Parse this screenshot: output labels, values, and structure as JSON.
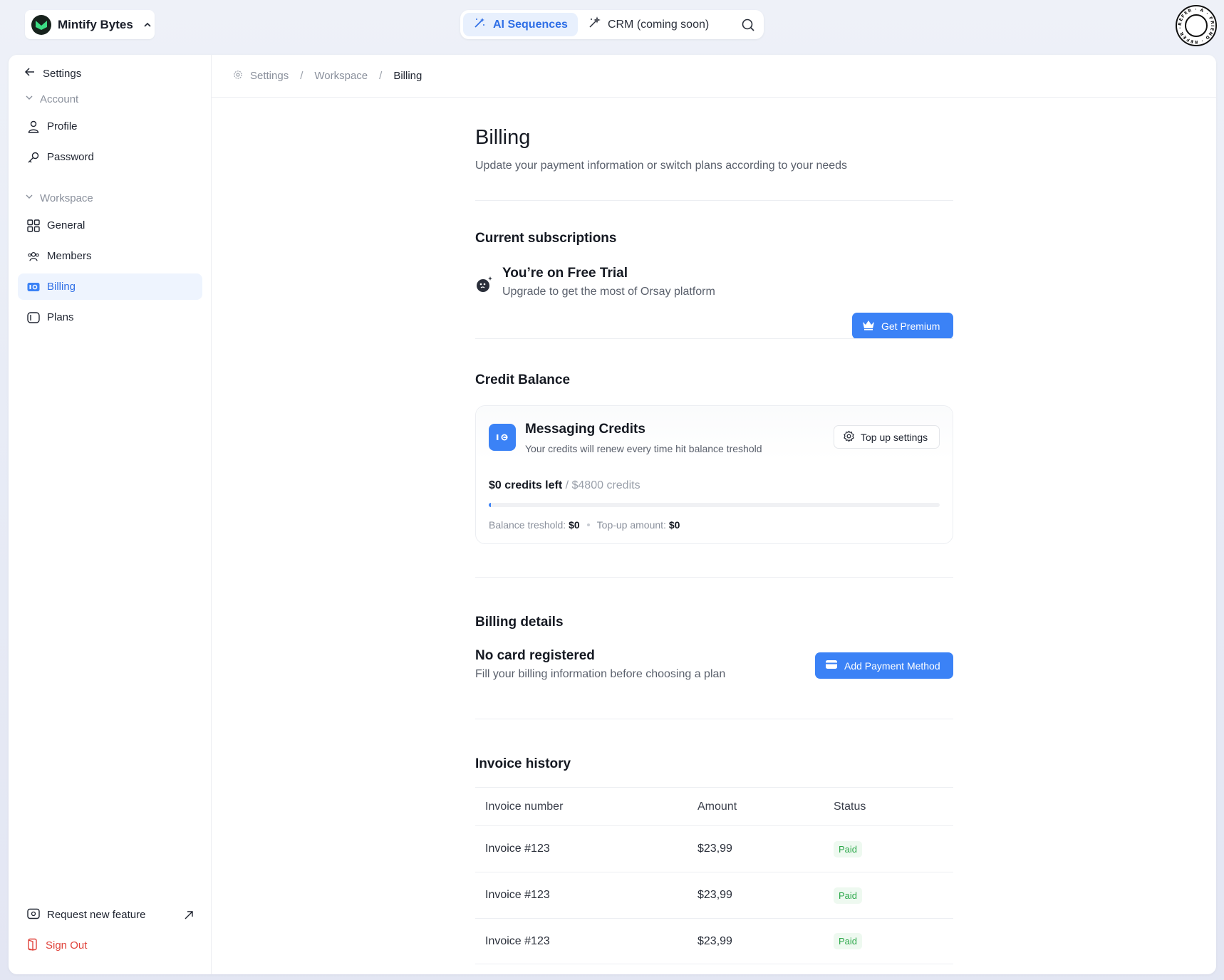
{
  "workspace": {
    "name": "Mintify Bytes"
  },
  "top_nav": {
    "tabs": [
      {
        "label": "AI Sequences",
        "active": true
      },
      {
        "label": "CRM (coming soon)",
        "active": false
      }
    ]
  },
  "sidebar": {
    "back_label": "Settings",
    "groups": {
      "account": "Account",
      "workspace": "Workspace"
    },
    "items": [
      {
        "label": "Profile"
      },
      {
        "label": "Password"
      },
      {
        "label": "General"
      },
      {
        "label": "Members"
      },
      {
        "label": "Billing",
        "active": true
      },
      {
        "label": "Plans"
      }
    ],
    "bottom": {
      "request_feature": "Request new feature",
      "sign_out": "Sign Out"
    }
  },
  "breadcrumb": [
    "Settings",
    "Workspace",
    "Billing"
  ],
  "page": {
    "title": "Billing",
    "subtitle": "Update your payment information or switch plans according to your needs"
  },
  "subscriptions": {
    "section_title": "Current subscriptions",
    "title": "You’re on Free Trial",
    "description": "Upgrade to get the most of Orsay platform",
    "button": "Get Premium"
  },
  "credits": {
    "section_title": "Credit Balance",
    "card_title": "Messaging Credits",
    "card_desc": "Your credits will renew every time hit balance treshold",
    "topup_button": "Top up settings",
    "left": "$0 credits left",
    "total": "/ $4800 credits",
    "progress_fraction": 0.005,
    "threshold_label": "Balance treshold",
    "threshold_value": "$0",
    "topup_label": "Top-up amount:",
    "topup_value": "$0"
  },
  "billing_details": {
    "section_title": "Billing details",
    "title": "No card registered",
    "description": "Fill your billing information before choosing a plan",
    "button": "Add Payment Method"
  },
  "invoices": {
    "section_title": "Invoice history",
    "columns": [
      "Invoice number",
      "Amount",
      "Status"
    ],
    "rows": [
      {
        "number": "Invoice #123",
        "amount": "$23,99",
        "status": "Paid"
      },
      {
        "number": "Invoice #123",
        "amount": "$23,99",
        "status": "Paid"
      },
      {
        "number": "Invoice #123",
        "amount": "$23,99",
        "status": "Paid"
      }
    ]
  },
  "colors": {
    "accent": "#3b82f6",
    "paid": "#2aa748",
    "danger": "#e0433b"
  }
}
